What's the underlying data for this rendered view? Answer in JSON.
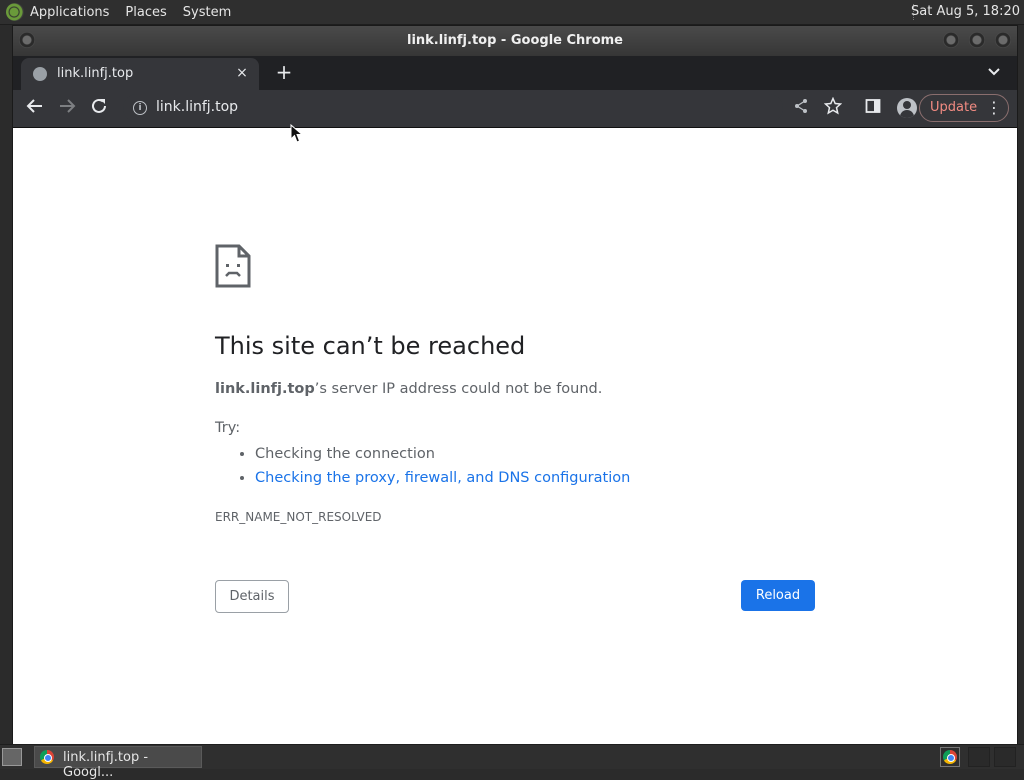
{
  "top_panel": {
    "menus": [
      "Applications",
      "Places",
      "System"
    ],
    "clock": "Sat Aug  5, 18:20"
  },
  "window": {
    "title": "link.linfj.top - Google Chrome"
  },
  "browser": {
    "tab": {
      "title": "link.linfj.top",
      "close_glyph": "×"
    },
    "new_tab_glyph": "+",
    "omnibox": {
      "url": "link.linfj.top"
    },
    "update_label": "Update",
    "icons": {
      "back": "back-arrow-icon",
      "forward": "forward-arrow-icon",
      "reload": "reload-icon",
      "info": "info-icon",
      "share": "share-icon",
      "bookmark": "star-icon",
      "side_panel": "side-panel-icon",
      "profile": "profile-icon",
      "menu": "kebab-menu-icon"
    }
  },
  "error_page": {
    "heading": "This site can’t be reached",
    "host": "link.linfj.top",
    "description_suffix": "’s server IP address could not be found.",
    "try_label": "Try:",
    "suggestions": [
      {
        "text": "Checking the connection",
        "is_link": false
      },
      {
        "text": "Checking the proxy, firewall, and DNS configuration",
        "is_link": true
      }
    ],
    "error_code": "ERR_NAME_NOT_RESOLVED",
    "details_button": "Details",
    "reload_button": "Reload",
    "colors": {
      "accent": "#1a73e8",
      "text": "#5f6368",
      "heading": "#202124"
    }
  },
  "taskbar": {
    "task_label": "link.linfj.top - Googl..."
  }
}
